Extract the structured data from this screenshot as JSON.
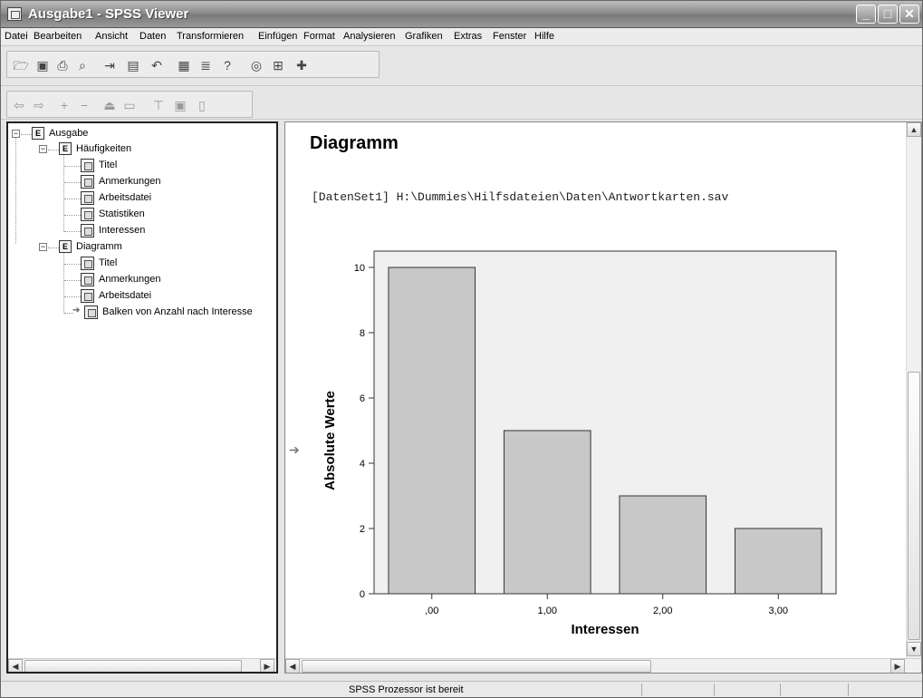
{
  "window": {
    "title": "Ausgabe1 - SPSS Viewer"
  },
  "menu": [
    "Datei",
    "Bearbeiten",
    "Ansicht",
    "Daten",
    "Transformieren",
    "Einfügen",
    "Format",
    "Analysieren",
    "Grafiken",
    "Extras",
    "Fenster",
    "Hilfe"
  ],
  "outline": {
    "root": "Ausgabe",
    "groups": [
      {
        "label": "Häufigkeiten",
        "items": [
          "Titel",
          "Anmerkungen",
          "Arbeitsdatei",
          "Statistiken",
          "Interessen"
        ]
      },
      {
        "label": "Diagramm",
        "items": [
          "Titel",
          "Anmerkungen",
          "Arbeitsdatei",
          "Balken von Anzahl nach Interesse"
        ]
      }
    ]
  },
  "content": {
    "title": "Diagramm",
    "dataset": "[DatenSet1] H:\\Dummies\\Hilfsdateien\\Daten\\Antwortkarten.sav"
  },
  "chart_data": {
    "type": "bar",
    "categories": [
      ",00",
      "1,00",
      "2,00",
      "3,00"
    ],
    "values": [
      10,
      5,
      3,
      2
    ],
    "xlabel": "Interessen",
    "ylabel": "Absolute Werte",
    "yticks": [
      "0",
      "2",
      "4",
      "6",
      "8",
      "10"
    ],
    "ylim": [
      0,
      10.5
    ],
    "grid": false,
    "colors": {
      "bar": "#c8c8c8",
      "plot_bg": "#f0f0f0",
      "outline": "#333333"
    }
  },
  "status": {
    "message": "SPSS Prozessor ist bereit"
  },
  "icons": {
    "toolbar1": [
      "open-icon",
      "save-icon",
      "print-icon",
      "print-preview-icon",
      "export-icon",
      "goto-data-icon",
      "undo-icon",
      "variables-icon",
      "insert-case-icon",
      "help-icon",
      "chart-icon",
      "pivot-icon",
      "add-icon"
    ],
    "toolbar2": [
      "promote-icon",
      "demote-icon",
      "expand-icon",
      "collapse-icon",
      "show-icon",
      "hide-icon",
      "insert-heading-icon",
      "insert-title-icon",
      "insert-text-icon"
    ]
  }
}
